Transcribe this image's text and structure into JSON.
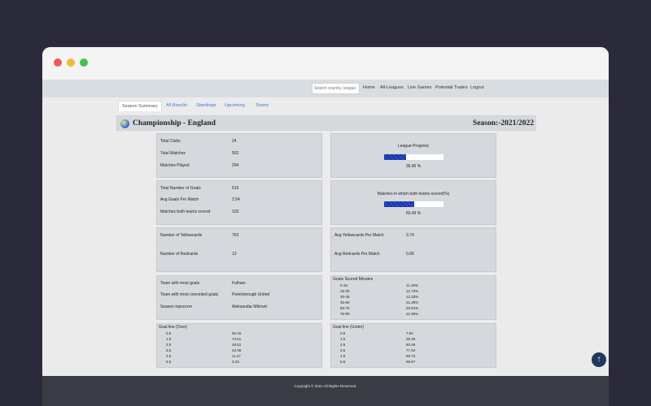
{
  "nav": {
    "search_placeholder": "Search country, league...",
    "links": [
      "Home",
      "All-Leagues",
      "Live Games",
      "Potential Trades",
      "Logout"
    ]
  },
  "tabs": [
    "Season Summary",
    "All Results",
    "Standings",
    "Upcoming",
    "Teams"
  ],
  "header": {
    "title": "Championship - England",
    "season": "Season:-2021/2022"
  },
  "club_stats": {
    "labels": [
      "Total Clubs",
      "Total Matches",
      "Matches Played"
    ],
    "values": [
      "24",
      "552",
      "204"
    ]
  },
  "league_progress": {
    "title": "League Progress",
    "percent_text": "36.96 %",
    "fraction": 0.3696
  },
  "goal_stats": {
    "labels": [
      "Total Number of Goals",
      "Avg Goals Per Match",
      "Matches both teams scored"
    ],
    "values": [
      "519",
      "2.54",
      "103"
    ]
  },
  "btts_progress": {
    "title": "Matches in which both teams scored(%)",
    "percent_text": "50.49 %",
    "fraction": 0.5049
  },
  "cards": {
    "labels": [
      "Number of Yellowcards",
      "Number of Redcards"
    ],
    "values": [
      "763",
      "13"
    ]
  },
  "avg_cards": {
    "labels": [
      "Avg Yellowcards Per Match",
      "Avg Redcards Per Match"
    ],
    "values": [
      "3.74",
      "0.06"
    ]
  },
  "team_stats": {
    "labels": [
      "Team with most goals",
      "Team with most conceded goals",
      "Season topscorer"
    ],
    "values": [
      "Fulham",
      "Peterborough United",
      "Aleksandar Mitrović"
    ]
  },
  "minutes": {
    "title": "Goals Scored Minutes",
    "ranges": [
      "0-15",
      "15-30",
      "30-45",
      "45-60",
      "60-75",
      "75-90"
    ],
    "values": [
      "11.18%",
      "12.72%",
      "12.33%",
      "21.39%",
      "20.81%",
      "21.58%"
    ]
  },
  "goal_line_over": {
    "title": "Goal line (Over)",
    "lines": [
      "0.5",
      "1.5",
      "2.5",
      "3.5",
      "4.5",
      "5.5"
    ],
    "values": [
      "92.16",
      "74.51",
      "49.51",
      "22.06",
      "11.27",
      "3.43"
    ]
  },
  "goal_line_under": {
    "title": "Goal line (Under)",
    "lines": [
      "0.5",
      "1.5",
      "2.5",
      "3.5",
      "4.5",
      "5.5"
    ],
    "values": [
      "7.84",
      "25.49",
      "50.49",
      "77.94",
      "88.73",
      "96.57"
    ]
  },
  "footer": {
    "copyright": "Copyright © 2021 All Rights Reserved."
  },
  "scroll_top_icon": "arrow-up-icon"
}
